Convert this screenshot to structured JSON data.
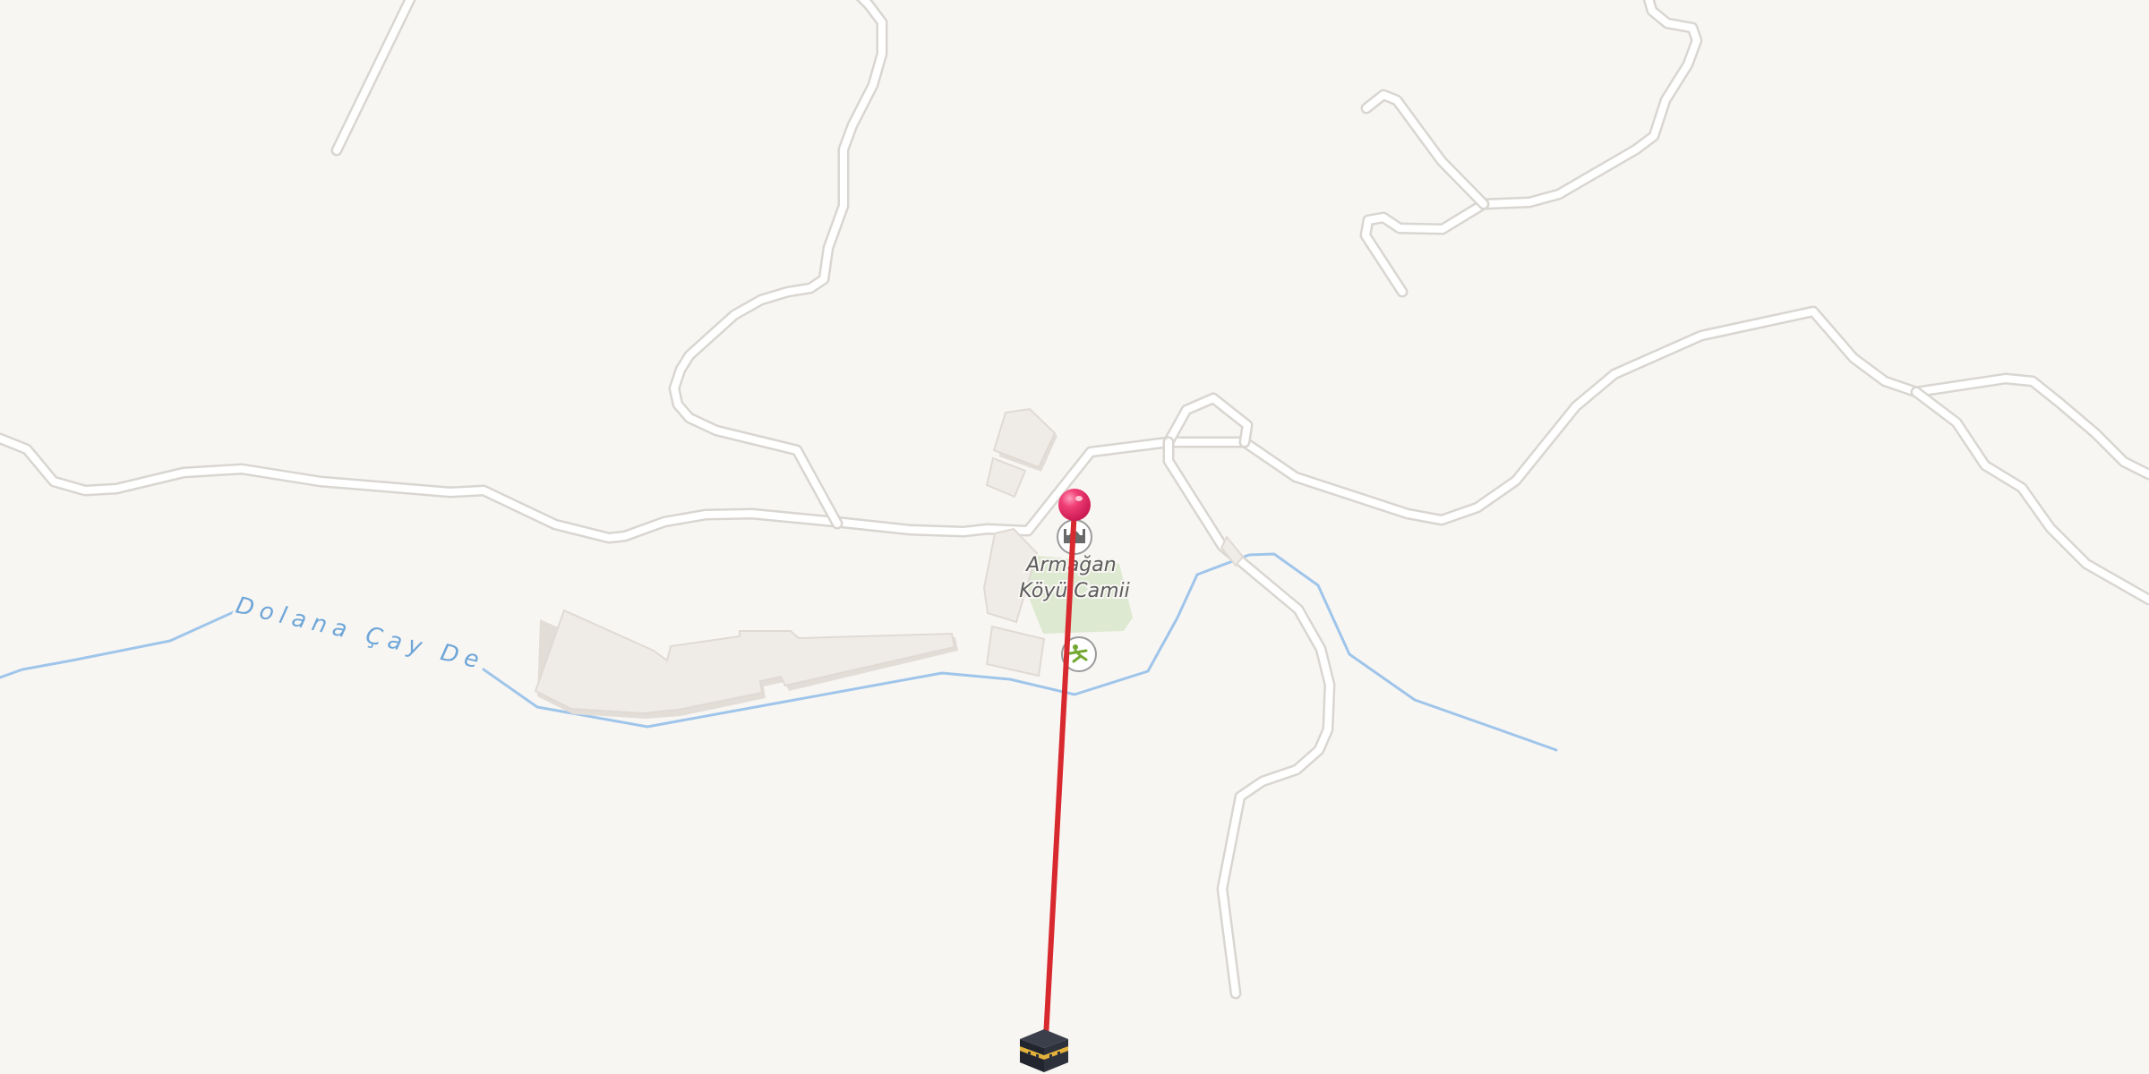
{
  "map": {
    "labels": {
      "river": "Dolana Çay Deresi",
      "mosque_line1": "Armağan",
      "mosque_line2": "Köyü Camii"
    },
    "icons": {
      "mosque": "mosque-icon",
      "playground": "playground-icon",
      "kaaba": "kaaba-icon",
      "location_pin": "location-pin-icon"
    },
    "colors": {
      "background": "#f8f6f3",
      "road": "#ffffff",
      "road_casing": "#d9d6d1",
      "river": "#9fc5ea",
      "qibla_line": "#d8292f",
      "pin": "#e8336a",
      "park": "#dde9d0"
    }
  }
}
